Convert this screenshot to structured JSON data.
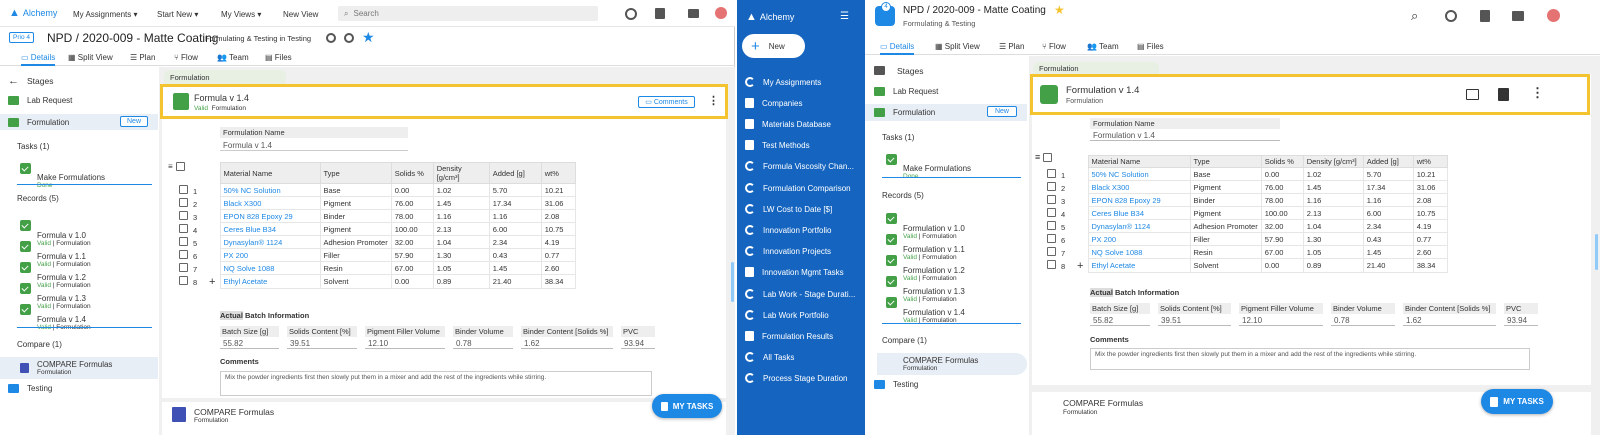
{
  "left": {
    "topnav": {
      "logo": "Alchemy",
      "items": [
        "My Assignments",
        "Start New",
        "My Views",
        "New View"
      ],
      "search_placeholder": "Search"
    },
    "header": {
      "prio": "Prio 4",
      "title": "NPD / 2020-009 - Matte Coating",
      "subtitle_prefix": "Formulating & Testing in",
      "subtitle_bold": "Testing"
    },
    "tabs": [
      "Details",
      "Split View",
      "Plan",
      "Flow",
      "Team",
      "Files"
    ],
    "stages_title": "Stages",
    "stages": [
      "Lab Request",
      "Formulation",
      "Testing"
    ],
    "new_label": "New",
    "tasks_title": "Tasks (1)",
    "task": {
      "name": "Make Formulations",
      "status": "Done"
    },
    "records_title": "Records (5)",
    "records": [
      {
        "name": "Formula v 1.0",
        "status": "Valid",
        "type": "| Formulation"
      },
      {
        "name": "Formula v 1.1",
        "status": "Valid",
        "type": "| Formulation"
      },
      {
        "name": "Formula v 1.2",
        "status": "Valid",
        "type": "| Formulation"
      },
      {
        "name": "Formula v 1.3",
        "status": "Valid",
        "type": "| Formulation"
      },
      {
        "name": "Formula v 1.4",
        "status": "Valid",
        "type": "| Formulation"
      }
    ],
    "compare_title": "Compare (1)",
    "compare": {
      "name": "COMPARE Formulas",
      "type": "Formulation"
    },
    "section_tab": "Formulation",
    "card": {
      "title": "Formula v 1.4",
      "status": "Valid",
      "type": "Formulation",
      "comments": "Comments"
    },
    "bottom_card": {
      "title": "COMPARE Formulas",
      "type": "Formulation"
    },
    "fab": "MY TASKS"
  },
  "right": {
    "logo": "Alchemy",
    "new_label": "New",
    "sidebar": [
      "My Assignments",
      "Companies",
      "Materials Database",
      "Test Methods",
      "Formula Viscosity Chan...",
      "Formulation Comparison",
      "LW Cost to Date [$]",
      "Innovation Portfolio",
      "Innovation Projects",
      "Innovation Mgmt Tasks",
      "Lab Work - Stage Durati...",
      "Lab Work Portfolio",
      "Formulation Results",
      "All Tasks",
      "Process Stage Duration"
    ],
    "header": {
      "badge": "4",
      "title": "NPD / 2020-009 - Matte Coating",
      "subtitle": "Formulating & Testing"
    },
    "tabs": [
      "Details",
      "Split View",
      "Plan",
      "Flow",
      "Team",
      "Files"
    ],
    "stages_title": "Stages",
    "stages": [
      "Lab Request",
      "Formulation",
      "Testing"
    ],
    "stage_new": "New",
    "tasks_title": "Tasks (1)",
    "task": {
      "name": "Make Formulations",
      "status": "Done"
    },
    "records_title": "Records (5)",
    "records": [
      {
        "name": "Formulation v 1.0",
        "status": "Valid",
        "type": "| Formulation"
      },
      {
        "name": "Formulation v 1.1",
        "status": "Valid",
        "type": "| Formulation"
      },
      {
        "name": "Formulation v 1.2",
        "status": "Valid",
        "type": "| Formulation"
      },
      {
        "name": "Formulation v 1.3",
        "status": "Valid",
        "type": "| Formulation"
      },
      {
        "name": "Formulation v 1.4",
        "status": "Valid",
        "type": "| Formulation"
      }
    ],
    "compare_title": "Compare (1)",
    "compare": {
      "name": "COMPARE Formulas",
      "type": "Formulation"
    },
    "section_tab": "Formulation",
    "card": {
      "title": "Formulation v 1.4",
      "type": "Formulation"
    },
    "bottom_card": {
      "title": "COMPARE Formulas",
      "type": "Formulation"
    },
    "fab": "MY TASKS"
  },
  "formulation": {
    "name_label": "Formulation Name",
    "name_value": "Formula v 1.4",
    "name_value_right": "Formulation v 1.4",
    "columns": [
      "Material Name",
      "Type",
      "Solids %",
      "Density [g/cm³]",
      "Added [g]",
      "wt%"
    ],
    "rows": [
      [
        "1",
        "50% NC Solution",
        "Base",
        "0.00",
        "1.02",
        "5.70",
        "10.21"
      ],
      [
        "2",
        "Black X300",
        "Pigment",
        "76.00",
        "1.45",
        "17.34",
        "31.06"
      ],
      [
        "3",
        "EPON 828 Epoxy 29",
        "Binder",
        "78.00",
        "1.16",
        "1.16",
        "2.08"
      ],
      [
        "4",
        "Ceres Blue B34",
        "Pigment",
        "100.00",
        "2.13",
        "6.00",
        "10.75"
      ],
      [
        "5",
        "Dynasylan® 1124",
        "Adhesion Promoter",
        "32.00",
        "1.04",
        "2.34",
        "4.19"
      ],
      [
        "6",
        "PX 200",
        "Filler",
        "57.90",
        "1.30",
        "0.43",
        "0.77"
      ],
      [
        "7",
        "NQ Solve 1088",
        "Resin",
        "67.00",
        "1.05",
        "1.45",
        "2.60"
      ],
      [
        "8",
        "Ethyl Acetate",
        "Solvent",
        "0.00",
        "0.89",
        "21.40",
        "38.34"
      ]
    ],
    "batch_title_hl": "Actual",
    "batch_title_rest": " Batch Information",
    "batch_fields": [
      {
        "label": "Batch Size [g]",
        "value": "55.82"
      },
      {
        "label": "Solids Content [%]",
        "value": "39.51"
      },
      {
        "label": "Pigment Filler Volume",
        "value": "12.10"
      },
      {
        "label": "Binder Volume",
        "value": "0.78"
      },
      {
        "label": "Binder Content [Solids %]",
        "value": "1.62"
      },
      {
        "label": "PVC",
        "value": "93.94"
      }
    ],
    "comments_label": "Comments",
    "comments_value": "Mix the powder ingredients first then slowly put them in a mixer and add the rest of the ingredients while stirring."
  },
  "colors": {
    "accent": "#1e88e5",
    "sidebar": "#1565c0",
    "valid": "#43a047",
    "highlight": "#f4c430"
  }
}
